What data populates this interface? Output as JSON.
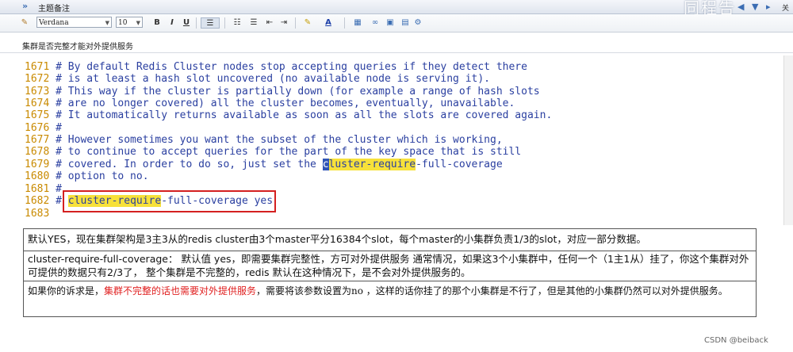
{
  "header": {
    "title": "主题备注",
    "watermark": "同程告",
    "close_label": "关闭"
  },
  "toolbar": {
    "font_name": "Verdana",
    "font_size": "10",
    "bold": "B",
    "italic": "I",
    "underline": "U"
  },
  "note": {
    "label": "集群是否完整才能对外提供服务"
  },
  "editor": {
    "lines": [
      {
        "num": "1671",
        "text": " # By default Redis Cluster nodes stop accepting queries if they detect there"
      },
      {
        "num": "1672",
        "text": " # is at least a hash slot uncovered (no available node is serving it)."
      },
      {
        "num": "1673",
        "text": " # This way if the cluster is partially down (for example a range of hash slots"
      },
      {
        "num": "1674",
        "text": " # are no longer covered) all the cluster becomes, eventually, unavailable."
      },
      {
        "num": "1675",
        "text": " # It automatically returns available as soon as all the slots are covered again."
      },
      {
        "num": "1676",
        "text": " #"
      },
      {
        "num": "1677",
        "text": " # However sometimes you want the subset of the cluster which is working,"
      },
      {
        "num": "1678",
        "text": " # to continue to accept queries for the part of the key space that is still"
      },
      {
        "num": "1679a",
        "text": " # covered. In order to do so, just set the "
      },
      {
        "num": "1680",
        "text": " # option to no."
      },
      {
        "num": "1681",
        "text": " #"
      },
      {
        "num": "1683",
        "text": ""
      }
    ],
    "line1679": {
      "num": "1679",
      "pre": " # covered. In order to do so, just set the ",
      "cursor": "c",
      "hl": "luster-require",
      "post": "-full-coverage"
    },
    "line1682": {
      "num": "1682",
      "pre": " # ",
      "hl": "cluster-require",
      "post": "-full-coverage yes"
    }
  },
  "explain": {
    "row1": "默认YES，现在集群架构是3主3从的redis cluster由3个master平分16384个slot，每个master的小集群负责1/3的slot，对应一部分数据。",
    "row2": "cluster-require-full-coverage： 默认值 yes，即需要集群完整性，方可对外提供服务 通常情况，如果这3个小集群中，任何一个（1主1从）挂了，你这个集群对外可提供的数据只有2/3了， 整个集群是不完整的，redis 默认在这种情况下，是不会对外提供服务的。",
    "row3_pre": "如果你的诉求是，",
    "row3_red": "集群不完整的话也需要对外提供服务",
    "row3_post": "，需要将该参数设置为no ，这样的话你挂了的那个小集群是不行了，但是其他的小集群仍然可以对外提供服务。"
  },
  "footer": {
    "credit": "CSDN @beiback"
  }
}
